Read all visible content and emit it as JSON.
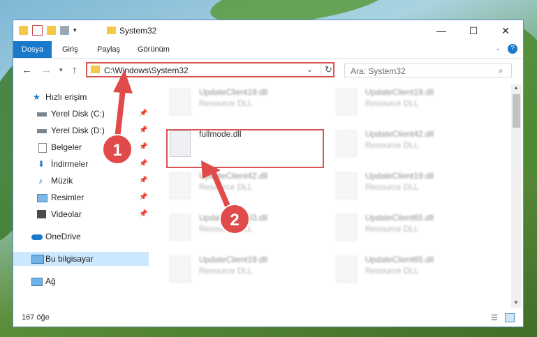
{
  "window": {
    "title": "System32",
    "minimize": "—",
    "maximize": "☐",
    "close": "✕"
  },
  "ribbon": {
    "tabs": [
      {
        "label": "Dosya",
        "active": true
      },
      {
        "label": "Giriş"
      },
      {
        "label": "Paylaş"
      },
      {
        "label": "Görünüm"
      }
    ]
  },
  "address": {
    "path": "C:\\Windows\\System32",
    "search_placeholder": "Ara: System32"
  },
  "sidebar": {
    "items": [
      {
        "label": "Hızlı erişim",
        "icon": "star-icon"
      },
      {
        "label": "Yerel Disk (C:)",
        "icon": "drive-icon",
        "pinned": true
      },
      {
        "label": "Yerel Disk (D:)",
        "icon": "drive-icon",
        "pinned": true
      },
      {
        "label": "Belgeler",
        "icon": "documents-icon",
        "pinned": true
      },
      {
        "label": "İndirmeler",
        "icon": "download-icon",
        "pinned": true
      },
      {
        "label": "Müzik",
        "icon": "music-icon",
        "pinned": true
      },
      {
        "label": "Resimler",
        "icon": "pictures-icon",
        "pinned": true
      },
      {
        "label": "Videolar",
        "icon": "videos-icon",
        "pinned": true
      },
      {
        "label": "OneDrive",
        "icon": "onedrive-icon"
      },
      {
        "label": "Bu bilgisayar",
        "icon": "computer-icon",
        "selected": true
      },
      {
        "label": "Ağ",
        "icon": "network-icon"
      }
    ]
  },
  "files": [
    {
      "name": "UpdateClient19.dll",
      "type": "Resource DLL",
      "blurred": true
    },
    {
      "name": "UpdateClient19.dll",
      "type": "Resource DLL",
      "blurred": true
    },
    {
      "name": "fullmode.dll",
      "type": "",
      "blurred": false
    },
    {
      "name": "UpdateClient42.dll",
      "type": "Resource DLL",
      "blurred": true
    },
    {
      "name": "UpdateClient42.dll",
      "type": "Resource DLL",
      "blurred": true
    },
    {
      "name": "UpdateClient19.dll",
      "type": "Resource DLL",
      "blurred": true
    },
    {
      "name": "UpdateClient63.dll",
      "type": "Resource DLL",
      "blurred": true
    },
    {
      "name": "UpdateClient65.dll",
      "type": "Resource DLL",
      "blurred": true
    },
    {
      "name": "UpdateClient19.dll",
      "type": "Resource DLL",
      "blurred": true
    },
    {
      "name": "UpdateClient65.dll",
      "type": "Resource DLL",
      "blurred": true
    }
  ],
  "annotations": {
    "step1": "1",
    "step2": "2"
  },
  "status": {
    "count": "167 öğe"
  },
  "colors": {
    "accent": "#1979ca",
    "highlight": "#d9534f",
    "badge": "#e04a4a"
  }
}
